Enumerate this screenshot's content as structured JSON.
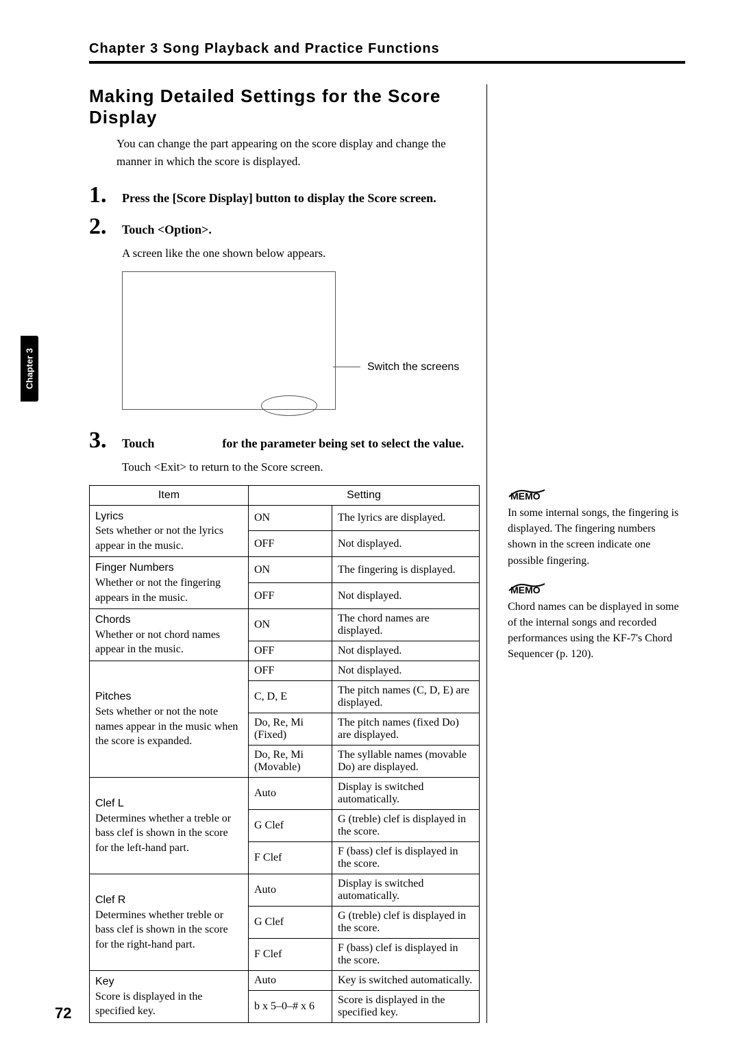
{
  "chapter_header": "Chapter 3 Song Playback and Practice Functions",
  "tab_label": "Chapter 3",
  "page_number": "72",
  "section_title": "Making Detailed Settings for the Score Display",
  "intro": "You can change the part appearing on the score display and change the manner in which the score is displayed.",
  "steps": {
    "s1": {
      "num": "1.",
      "text": "Press the [Score Display] button to display the Score screen."
    },
    "s2": {
      "num": "2.",
      "text": "Touch <Option>.",
      "after": "A screen like the one shown below appears."
    },
    "s3": {
      "num": "3.",
      "pre": "Touch ",
      "post": " for the parameter being set to select the value.",
      "after": "Touch <Exit> to return to the Score screen."
    }
  },
  "figure_caption": "Switch the screens",
  "table_header": {
    "item": "Item",
    "setting": "Setting"
  },
  "rows": {
    "lyrics": {
      "name": "Lyrics",
      "desc": "Sets whether or not the lyrics appear in the music.",
      "v1": "ON",
      "d1": "The lyrics are displayed.",
      "v2": "OFF",
      "d2": "Not displayed."
    },
    "finger": {
      "name": "Finger Numbers",
      "desc": "Whether or not the fingering appears in the music.",
      "v1": "ON",
      "d1": "The fingering is displayed.",
      "v2": "OFF",
      "d2": "Not displayed."
    },
    "chords": {
      "name": "Chords",
      "desc": "Whether or not chord names appear in the music.",
      "v1": "ON",
      "d1": "The chord names are displayed.",
      "v2": "OFF",
      "d2": "Not displayed."
    },
    "pitches": {
      "name": "Pitches",
      "desc": "Sets whether or not the note names appear in the music when the score is expanded.",
      "v1": "OFF",
      "d1": "Not displayed.",
      "v2": "C, D, E",
      "d2": "The pitch names (C, D, E) are displayed.",
      "v3": "Do, Re, Mi (Fixed)",
      "d3": "The pitch names (fixed Do) are displayed.",
      "v4": "Do, Re, Mi (Movable)",
      "d4": "The syllable names (movable Do) are displayed."
    },
    "clefL": {
      "name": "Clef L",
      "desc": "Determines whether a treble or bass clef is shown in the score for the left-hand part.",
      "v1": "Auto",
      "d1": "Display is switched automatically.",
      "v2": "G Clef",
      "d2": "G (treble) clef is displayed in the score.",
      "v3": "F Clef",
      "d3": "F (bass) clef is displayed in the score."
    },
    "clefR": {
      "name": "Clef R",
      "desc": "Determines whether treble or bass clef is shown in the score for the right-hand part.",
      "v1": "Auto",
      "d1": "Display is switched automatically.",
      "v2": "G Clef",
      "d2": "G (treble) clef is displayed in the score.",
      "v3": "F Clef",
      "d3": "F (bass) clef is displayed in the score."
    },
    "key": {
      "name": "Key",
      "desc": "Score is displayed in the specified key.",
      "v1": "Auto",
      "d1": "Key is switched automatically.",
      "v2": "b x 5–0–# x 6",
      "d2": "Score is displayed in the specified key."
    }
  },
  "memo_label": "MEMO",
  "memo1": "In some internal songs, the fingering is displayed. The fingering numbers shown in the screen indicate one possible fingering.",
  "memo2": "Chord names can be displayed in some of the internal songs and recorded performances using the KF-7's Chord Sequencer (p. 120)."
}
